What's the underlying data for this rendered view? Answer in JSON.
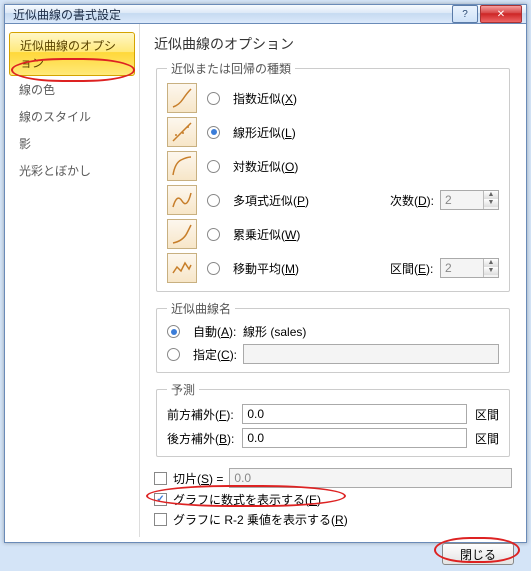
{
  "window": {
    "title": "近似曲線の書式設定"
  },
  "sidebar": {
    "items": [
      {
        "label": "近似曲線のオプション",
        "active": true
      },
      {
        "label": "線の色"
      },
      {
        "label": "線のスタイル"
      },
      {
        "label": "影"
      },
      {
        "label": "光彩とぼかし"
      }
    ]
  },
  "main": {
    "heading": "近似曲線のオプション",
    "types_legend": "近似または回帰の種類",
    "types": [
      {
        "label": "指数近似",
        "key": "X"
      },
      {
        "label": "線形近似",
        "key": "L",
        "checked": true
      },
      {
        "label": "対数近似",
        "key": "O"
      },
      {
        "label": "多項式近似",
        "key": "P",
        "order_label": "次数",
        "order_key": "D",
        "order": "2"
      },
      {
        "label": "累乗近似",
        "key": "W"
      },
      {
        "label": "移動平均",
        "key": "M",
        "span_label": "区間",
        "span_key": "E",
        "span": "2"
      }
    ],
    "name_legend": "近似曲線名",
    "name": {
      "auto_label": "自動",
      "auto_key": "A",
      "auto_checked": true,
      "auto_value": "線形 (sales)",
      "custom_label": "指定",
      "custom_key": "C",
      "custom_value": ""
    },
    "forecast_legend": "予測",
    "forecast": {
      "forward_label": "前方補外",
      "forward_key": "F",
      "forward_value": "0.0",
      "unit_f": "区間",
      "backward_label": "後方補外",
      "backward_key": "B",
      "backward_value": "0.0",
      "unit_b": "区間"
    },
    "options": {
      "intercept_label": "切片",
      "intercept_key": "S",
      "intercept_eq": "=",
      "intercept_value": "0.0",
      "equation_label": "グラフに数式を表示する",
      "equation_key": "E",
      "equation_checked": true,
      "r2_label": "グラフに R-2 乗値を表示する",
      "r2_key": "R"
    },
    "close_label": "閉じる"
  }
}
